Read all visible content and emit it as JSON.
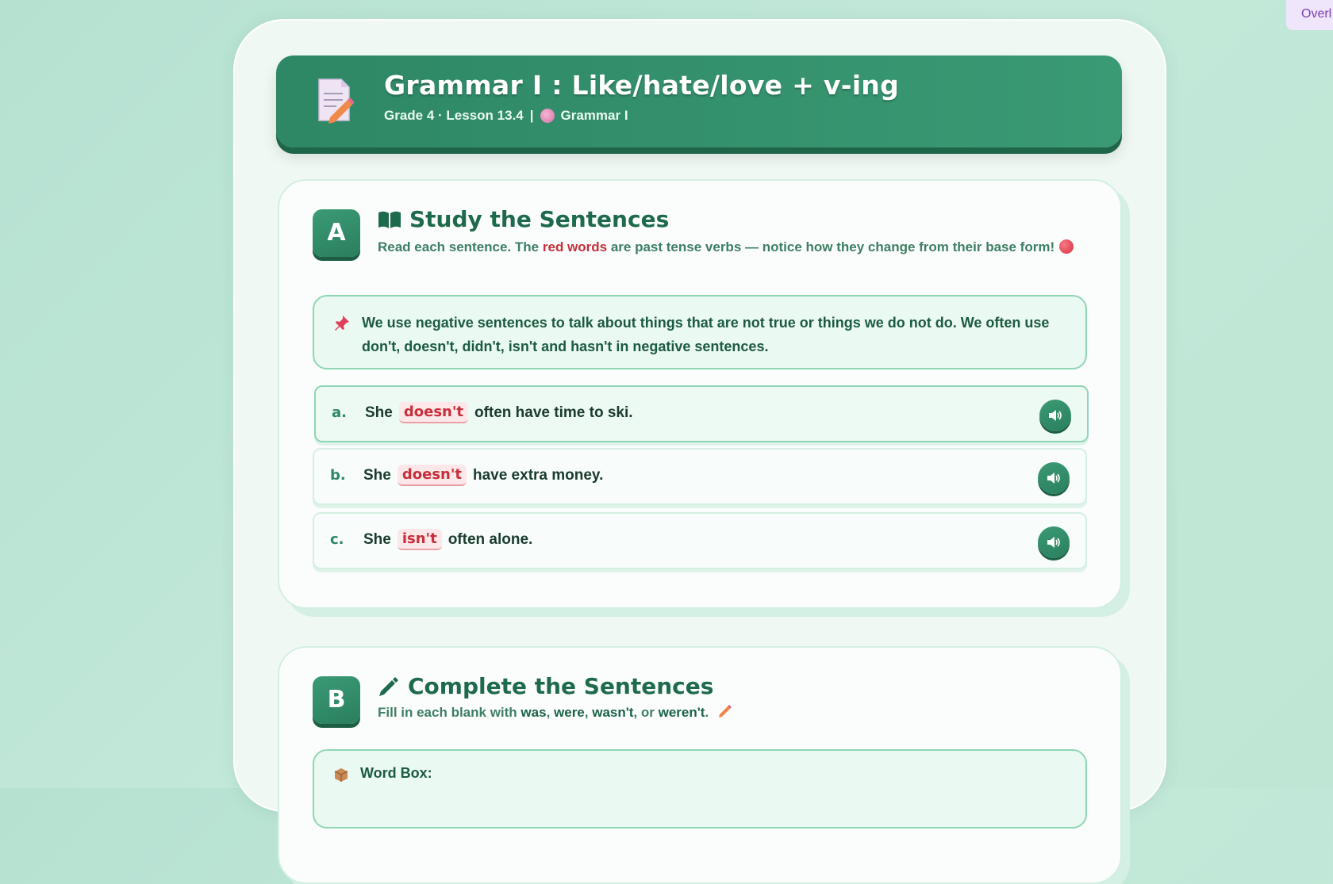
{
  "overlay": {
    "label": "Overl"
  },
  "header": {
    "title": "Grammar I : Like/hate/love + v-ing",
    "grade_lesson": "Grade 4 · Lesson 13.4",
    "separator": "|",
    "section": "Grammar I",
    "icon": "memo-pencil-icon"
  },
  "section_a": {
    "badge": "A",
    "title": "Study the Sentences",
    "icon": "open-book-icon",
    "desc_before": "Read each sentence. The ",
    "desc_highlight": "red words",
    "desc_after": " are past tense verbs — notice how they change from their base form!",
    "note": "We use negative sentences to talk about things that are not true or things we do not do. We often use don't, doesn't, didn't, isn't and hasn't in negative sentences.",
    "sentences": [
      {
        "label": "a.",
        "before": "She",
        "highlight": "doesn't",
        "after": "often have time to ski."
      },
      {
        "label": "b.",
        "before": "She",
        "highlight": "doesn't",
        "after": "have extra money."
      },
      {
        "label": "c.",
        "before": "She",
        "highlight": "isn't",
        "after": "often alone."
      }
    ]
  },
  "section_b": {
    "badge": "B",
    "title": "Complete the Sentences",
    "icon": "pencil-icon",
    "desc_before": "Fill in each blank with ",
    "word1": "was",
    "word2": "were",
    "word3": "wasn't",
    "word4": "weren't",
    "sep1": ", ",
    "sep2": ", ",
    "sep3": ", or ",
    "desc_end": ".",
    "word_box_label": "Word Box:"
  },
  "colors": {
    "primary": "#2e8765",
    "highlight_red": "#c62f3b",
    "background": "#bfe5d4"
  }
}
